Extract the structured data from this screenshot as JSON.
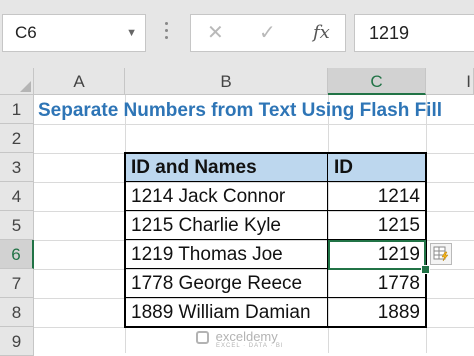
{
  "formula_bar": {
    "name_box": "C6",
    "formula_value": "1219",
    "cancel_glyph": "✕",
    "enter_glyph": "✓",
    "fx_glyph": "fx"
  },
  "columns": [
    "A",
    "B",
    "C",
    "I"
  ],
  "rows": [
    "1",
    "2",
    "3",
    "4",
    "5",
    "6",
    "7",
    "8",
    "9"
  ],
  "sheet": {
    "title": "Separate Numbers from Text Using Flash Fill",
    "table": {
      "headers": [
        "ID and Names",
        "ID"
      ],
      "rows": [
        [
          "1214 Jack Connor",
          "1214"
        ],
        [
          "1215 Charlie Kyle",
          "1215"
        ],
        [
          "1219 Thomas Joe",
          "1219"
        ],
        [
          "1778 George Reece",
          "1778"
        ],
        [
          "1889 William Damian",
          "1889"
        ]
      ]
    }
  },
  "selection": {
    "active_cell": "C6",
    "active_column": "C",
    "active_row": "6"
  },
  "watermark": {
    "name": "exceldemy",
    "tagline": "EXCEL · DATA · BI"
  },
  "colors": {
    "accent_green": "#217346",
    "title_blue": "#2e75b6",
    "header_fill": "#bdd7ee"
  },
  "icons": [
    "dropdown-icon",
    "cancel-icon",
    "enter-icon",
    "function-icon",
    "flash-fill-options-icon"
  ]
}
